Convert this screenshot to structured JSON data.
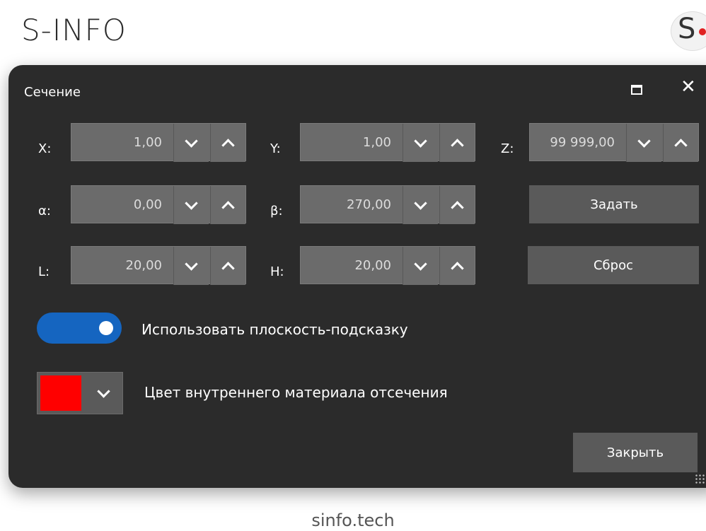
{
  "brand": {
    "name": "S-INFO",
    "logo_letter": "S"
  },
  "footer": {
    "text": "sinfo.tech"
  },
  "dialog": {
    "title": "Сечение",
    "window_controls": [
      {
        "name": "maximize",
        "icon": "maximize-icon"
      },
      {
        "name": "close",
        "icon": "close-icon",
        "glyph": "✕"
      }
    ],
    "fields": {
      "x": {
        "label": "X:",
        "value": "1,00"
      },
      "y": {
        "label": "Y:",
        "value": "1,00"
      },
      "z": {
        "label": "Z:",
        "value": "99 999,00"
      },
      "alpha": {
        "label": "α:",
        "value": "0,00"
      },
      "beta": {
        "label": "β:",
        "value": "270,00"
      },
      "l": {
        "label": "L:",
        "value": "20,00"
      },
      "h": {
        "label": "H:",
        "value": "20,00"
      }
    },
    "buttons": {
      "set": "Задать",
      "reset": "Сброс",
      "close": "Закрыть"
    },
    "toggle": {
      "label": "Использовать плоскость-подсказку",
      "on": true,
      "color": "#1565c0"
    },
    "color_picker": {
      "label": "Цвет внутреннего материала отсечения",
      "color": "#ff0000"
    }
  },
  "colors": {
    "dialog_bg": "#2b2b2b",
    "field_bg": "#6b6b6b",
    "button_bg": "#5a5a5a",
    "logo_dot": "#e02020"
  }
}
